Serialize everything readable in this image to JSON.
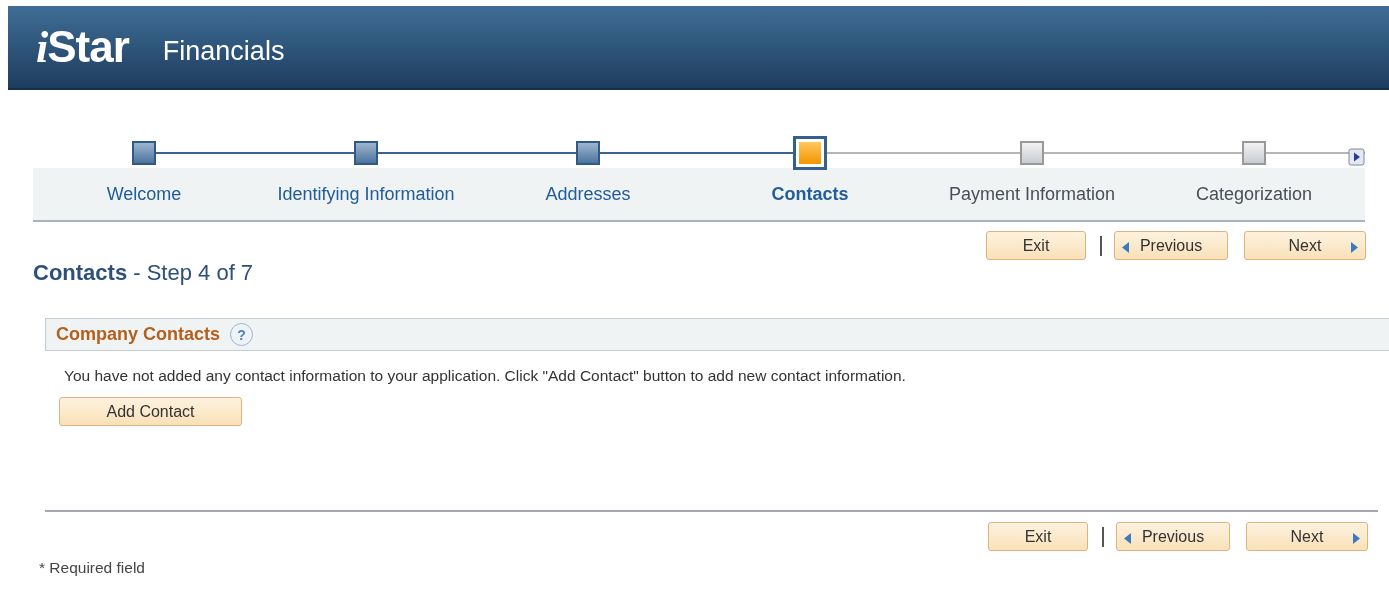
{
  "header": {
    "logo": "iStar",
    "product": "Financials"
  },
  "steps": [
    {
      "label": "Welcome",
      "completed": true,
      "selected": false
    },
    {
      "label": "Identifying Information",
      "completed": true,
      "selected": false
    },
    {
      "label": "Addresses",
      "completed": true,
      "selected": false
    },
    {
      "label": "Contacts",
      "completed": false,
      "selected": true
    },
    {
      "label": "Payment Information",
      "completed": false,
      "selected": false
    },
    {
      "label": "Categorization",
      "completed": false,
      "selected": false
    }
  ],
  "top_nav": [
    {
      "kind": "exit",
      "label": "Exit"
    },
    {
      "kind": "previous",
      "label": "Previous"
    },
    {
      "kind": "next",
      "label": "Next"
    }
  ],
  "page_title": {
    "main": "Contacts",
    "suffix": "- Step 4 of 7"
  },
  "section": {
    "title": "Company Contacts",
    "help": "?",
    "message": "You have not added any contact information to your application. Click \"Add Contact\" button to add new contact information.",
    "button": "Add Contact"
  },
  "bottom_nav": [
    {
      "kind": "exit",
      "label": "Exit"
    },
    {
      "kind": "previous",
      "label": "Previous"
    },
    {
      "kind": "next",
      "label": "Next"
    }
  ],
  "footnote": "* Required field"
}
